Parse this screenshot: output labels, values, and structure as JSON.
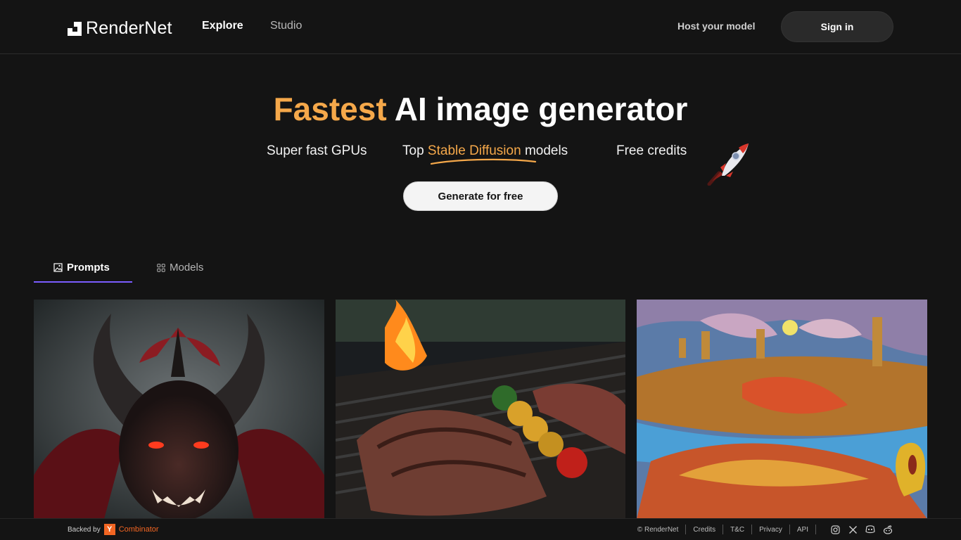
{
  "header": {
    "logo_text": "RenderNet",
    "nav": {
      "explore": "Explore",
      "studio": "Studio"
    },
    "host_link": "Host your model",
    "signin_label": "Sign in"
  },
  "hero": {
    "title_accent": "Fastest",
    "title_rest": "AI image generator",
    "features": {
      "gpus": "Super fast GPUs",
      "top_prefix": "Top",
      "top_accent": "Stable Diffusion",
      "top_suffix": "models",
      "credits": "Free credits"
    },
    "cta_label": "Generate for free",
    "accent_color": "#f5a84a"
  },
  "tabs": [
    {
      "label": "Prompts",
      "icon": "image-icon",
      "active": true
    },
    {
      "label": "Models",
      "icon": "grid-icon",
      "active": false
    }
  ],
  "gallery": [
    {
      "alt": "demon-image"
    },
    {
      "alt": "grill-image"
    },
    {
      "alt": "landscape-painting-image"
    }
  ],
  "footer": {
    "backed_by": "Backed by",
    "yc_letter": "Y",
    "yc_name": "Combinator",
    "links": [
      "© RenderNet",
      "Credits",
      "T&C",
      "Privacy",
      "API"
    ],
    "social_icons": [
      "instagram-icon",
      "x-icon",
      "discord-icon",
      "reddit-icon"
    ]
  },
  "colors": {
    "background": "#141414",
    "tab_indicator": "#7b5cff",
    "yc_orange": "#f26522"
  }
}
